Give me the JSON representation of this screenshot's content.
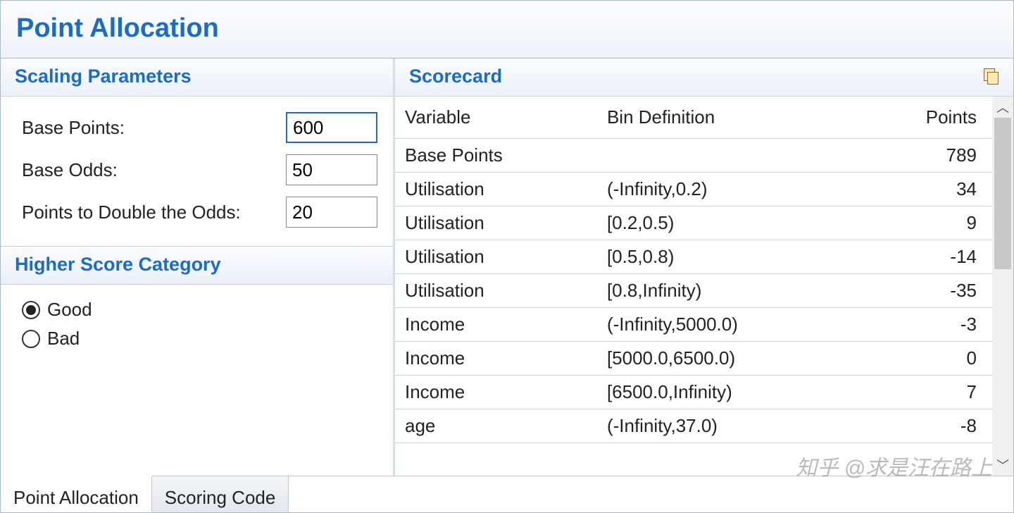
{
  "title": "Point Allocation",
  "scaling": {
    "header": "Scaling Parameters",
    "base_points_label": "Base Points:",
    "base_points_value": "600",
    "base_odds_label": "Base Odds:",
    "base_odds_value": "50",
    "pdo_label": "Points to Double the Odds:",
    "pdo_value": "20"
  },
  "category": {
    "header": "Higher Score Category",
    "options": [
      {
        "label": "Good",
        "selected": true
      },
      {
        "label": "Bad",
        "selected": false
      }
    ]
  },
  "scorecard": {
    "header": "Scorecard",
    "columns": {
      "variable": "Variable",
      "bin": "Bin Definition",
      "points": "Points"
    },
    "rows": [
      {
        "variable": "Base Points",
        "bin": "",
        "points": "789"
      },
      {
        "variable": "Utilisation",
        "bin": "(-Infinity,0.2)",
        "points": "34"
      },
      {
        "variable": "Utilisation",
        "bin": "[0.2,0.5)",
        "points": "9"
      },
      {
        "variable": "Utilisation",
        "bin": "[0.5,0.8)",
        "points": "-14"
      },
      {
        "variable": "Utilisation",
        "bin": "[0.8,Infinity)",
        "points": "-35"
      },
      {
        "variable": "Income",
        "bin": "(-Infinity,5000.0)",
        "points": "-3"
      },
      {
        "variable": "Income",
        "bin": "[5000.0,6500.0)",
        "points": "0"
      },
      {
        "variable": "Income",
        "bin": "[6500.0,Infinity)",
        "points": "7"
      },
      {
        "variable": "age",
        "bin": "(-Infinity,37.0)",
        "points": "-8"
      }
    ]
  },
  "tabs": [
    {
      "label": "Point Allocation",
      "active": true
    },
    {
      "label": "Scoring Code",
      "active": false
    }
  ],
  "watermark": "知乎 @求是汪在路上"
}
